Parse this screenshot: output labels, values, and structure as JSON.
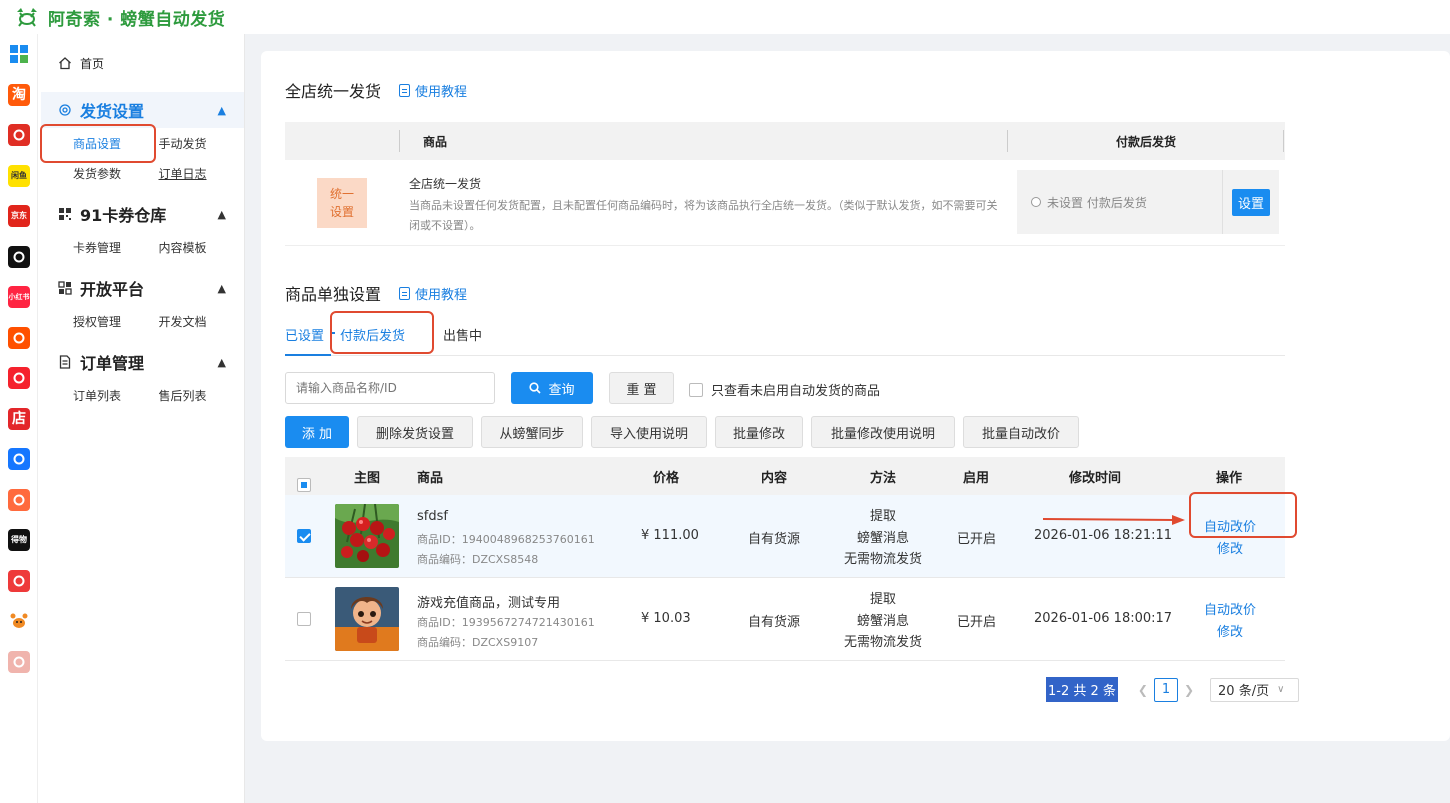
{
  "app": {
    "title": "阿奇索 · 螃蟹自动发货"
  },
  "rail": {
    "items": [
      {
        "icon": "grid-apps-icon",
        "label": "",
        "bg": "#ffffff"
      },
      {
        "icon": "taobao-icon",
        "label": "淘",
        "bg": "#ff5a0a"
      },
      {
        "icon": "pinduoduo-icon",
        "label": "",
        "bg": "#e02e24"
      },
      {
        "icon": "xianyu-icon",
        "label": "闲鱼",
        "bg": "#ffe100"
      },
      {
        "icon": "jd-icon",
        "label": "京东",
        "bg": "#e1251b"
      },
      {
        "icon": "douyin-icon",
        "label": "",
        "bg": "#111111"
      },
      {
        "icon": "xiaohongshu-icon",
        "label": "小红书",
        "bg": "#ff2442"
      },
      {
        "icon": "kuaishou-icon",
        "label": "",
        "bg": "#ff5000"
      },
      {
        "icon": "thumb-icon",
        "label": "",
        "bg": "#f5222d"
      },
      {
        "icon": "shop-icon",
        "label": "店",
        "bg": "#e3262a"
      },
      {
        "icon": "link-icon",
        "label": "",
        "bg": "#1677ff"
      },
      {
        "icon": "store-icon",
        "label": "",
        "bg": "#ff6a3d"
      },
      {
        "icon": "dewu-icon",
        "label": "得物",
        "bg": "#111111"
      },
      {
        "icon": "shield-app-icon",
        "label": "",
        "bg": "#ee3a3a"
      },
      {
        "icon": "crab-icon",
        "label": "",
        "bg": "#ffffff"
      },
      {
        "icon": "bag-icon",
        "label": "",
        "bg": "#f0b4ad"
      }
    ]
  },
  "sidebar": {
    "home": "首页",
    "groups": [
      {
        "title": "发货设置",
        "items": [
          "商品设置",
          "手动发货",
          "发货参数",
          "订单日志"
        ]
      },
      {
        "title": "91卡券仓库",
        "items": [
          "卡券管理",
          "内容模板"
        ]
      },
      {
        "title": "开放平台",
        "items": [
          "授权管理",
          "开发文档"
        ]
      },
      {
        "title": "订单管理",
        "items": [
          "订单列表",
          "售后列表"
        ]
      }
    ]
  },
  "global_section": {
    "title": "全店统一发货",
    "tutorial": "使用教程",
    "col_product": "商品",
    "col_after_pay": "付款后发货",
    "tag": "统一\n设置",
    "tag_line1": "统一",
    "tag_line2": "设置",
    "row_title": "全店统一发货",
    "row_desc": "当商品未设置任何发货配置，且未配置任何商品编码时，将为该商品执行全店统一发货。（类似于默认发货，如不需要可关闭或不设置）。",
    "status": "未设置 付款后发货",
    "set_button": "设置"
  },
  "single_section": {
    "title": "商品单独设置",
    "tutorial": "使用教程",
    "tabs": [
      "已设置",
      "付款后发货",
      "出售中"
    ],
    "search_placeholder": "请输入商品名称/ID",
    "query_button": "查询",
    "reset_button": "重 置",
    "only_unenabled": "只查看未启用自动发货的商品",
    "actions": [
      "添 加",
      "删除发货设置",
      "从螃蟹同步",
      "导入使用说明",
      "批量修改",
      "批量修改使用说明",
      "批量自动改价"
    ],
    "columns": [
      "主图",
      "商品",
      "价格",
      "内容",
      "方法",
      "启用",
      "修改时间",
      "操作"
    ],
    "rows": [
      {
        "checked": true,
        "name": "sfdsf",
        "product_id": "商品ID：1940048968253760161",
        "product_code": "商品编码：DZCXS8548",
        "price": "¥ 111.00",
        "content": "自有货源",
        "method": [
          "提取",
          "螃蟹消息",
          "无需物流发货"
        ],
        "enabled": "已开启",
        "modified": "2026-01-06 18:21:11",
        "ops": [
          "自动改价",
          "修改"
        ]
      },
      {
        "checked": false,
        "name": "游戏充值商品，测试专用",
        "product_id": "商品ID：1939567274721430161",
        "product_code": "商品编码：DZCXS9107",
        "price": "¥ 10.03",
        "content": "自有货源",
        "method": [
          "提取",
          "螃蟹消息",
          "无需物流发货"
        ],
        "enabled": "已开启",
        "modified": "2026-01-06 18:00:17",
        "ops": [
          "自动改价",
          "修改"
        ]
      }
    ],
    "pagination": {
      "total": "1-2 共 2 条",
      "current_page": "1",
      "page_size": "20 条/页"
    }
  },
  "colors": {
    "accent": "#1a8cf0",
    "brand_green": "#2e9b3e",
    "annotation_red": "#e04a30"
  }
}
